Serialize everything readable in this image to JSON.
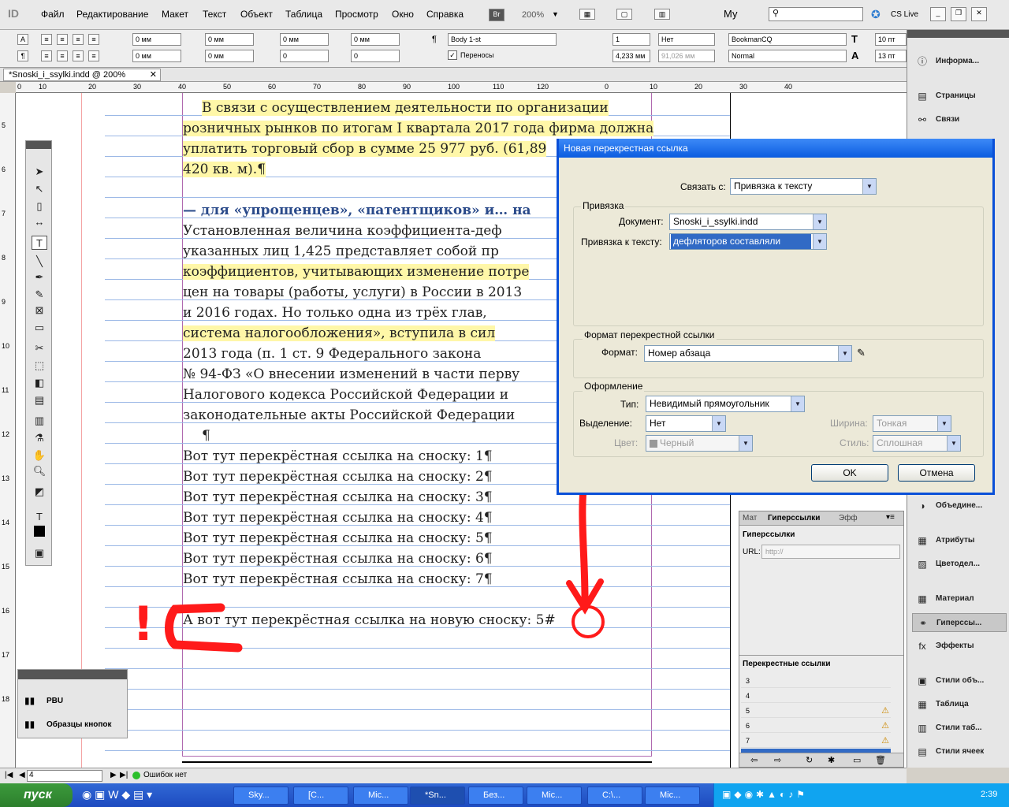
{
  "app": {
    "logo": "ID"
  },
  "menu": [
    "Файл",
    "Редактирование",
    "Макет",
    "Текст",
    "Объект",
    "Таблица",
    "Просмотр",
    "Окно",
    "Справка"
  ],
  "menubar_right": {
    "bridge": "Br",
    "zoom": "200%",
    "workspace": "Му",
    "cs_live": "CS Live"
  },
  "control": {
    "indent_left": "0 мм",
    "indent_right": "0 мм",
    "space_before": "0 мм",
    "space_after": "0 мм",
    "first_line": "0 мм",
    "last_line": "0 мм",
    "dropcap_lines": "0",
    "dropcap_chars": "0",
    "space_before2": "0 мм",
    "space_after2": "0 мм",
    "para_style": "Body 1-st",
    "hyphenation": "Переносы",
    "columns": "1",
    "columns_width": "4,233 мм",
    "span": "Нет",
    "span_width": "91,026 мм",
    "font_family": "BookmanCQ",
    "font_style": "Normal",
    "font_size": "10 пт",
    "leading": "13 пт"
  },
  "doc_tab": "*Snoski_i_ssylki.indd @ 200%",
  "ruler_top": [
    "0",
    "10",
    "20",
    "30",
    "40",
    "50",
    "60",
    "70",
    "80",
    "90",
    "100",
    "110",
    "120",
    "0",
    "10",
    "20",
    "30",
    "40"
  ],
  "ruler_left": [
    "5",
    "6",
    "7",
    "8",
    "9",
    "10",
    "11",
    "12",
    "13",
    "14",
    "15",
    "16",
    "17",
    "18"
  ],
  "text_lines": [
    {
      "t": "В связи с осуществлением деятельности по организации",
      "hl": true,
      "indent": true,
      "bold": false
    },
    {
      "t": "розничных рынков по итогам I квартала 2017 года фирма должна",
      "hl": true,
      "indent": false,
      "bold": false
    },
    {
      "t": "уплатить торговый сбор в сумме 25 977 руб. (61,89",
      "hl": true,
      "indent": false,
      "bold": false
    },
    {
      "t": "420 кв. м).¶",
      "hl": true,
      "indent": false,
      "bold": false
    },
    {
      "t": "— для «упрощенцев», «патентщиков» и… на",
      "hl": false,
      "indent": false,
      "bold": true
    },
    {
      "t": "Установленная величина коэффициента-деф",
      "hl": false,
      "indent": false,
      "bold": false
    },
    {
      "t": "указанных лиц 1,425 представляет собой пр",
      "hl": false,
      "indent": false,
      "bold": false
    },
    {
      "t": "коэффициентов, учитывающих изменение потре",
      "hl": true,
      "indent": false,
      "bold": false
    },
    {
      "t": "цен на товары (работы, услуги) в России в 2013",
      "hl": false,
      "indent": false,
      "bold": false
    },
    {
      "t": "и 2016 годах. Но только одна из трёх глав,",
      "hl": false,
      "indent": false,
      "bold": false
    },
    {
      "t": "система налогообложения», вступила в сил",
      "hl": true,
      "indent": false,
      "bold": false
    },
    {
      "t": "2013 года (п. 1 ст. 9 Федерального закона",
      "hl": false,
      "indent": false,
      "bold": false
    },
    {
      "t": "№ 94-ФЗ «О внесении изменений в части перву",
      "hl": false,
      "indent": false,
      "bold": false
    },
    {
      "t": "Налогового кодекса Российской Федерации и",
      "hl": false,
      "indent": false,
      "bold": false
    },
    {
      "t": "законодательные акты Российской Федерации",
      "hl": false,
      "indent": false,
      "bold": false
    },
    {
      "t": "¶",
      "hl": false,
      "indent": true,
      "bold": false
    },
    {
      "t": "Вот тут перекрёстная ссылка на сноску: 1¶",
      "hl": false,
      "indent": false,
      "bold": false
    },
    {
      "t": "Вот тут перекрёстная ссылка на сноску: 2¶",
      "hl": false,
      "indent": false,
      "bold": false
    },
    {
      "t": "Вот тут перекрёстная ссылка на сноску: 3¶",
      "hl": false,
      "indent": false,
      "bold": false
    },
    {
      "t": "Вот тут перекрёстная ссылка на сноску: 4¶",
      "hl": false,
      "indent": false,
      "bold": false
    },
    {
      "t": "Вот тут перекрёстная ссылка на сноску: 5¶",
      "hl": false,
      "indent": false,
      "bold": false
    },
    {
      "t": "Вот тут перекрёстная ссылка на сноску: 6¶",
      "hl": false,
      "indent": false,
      "bold": false
    },
    {
      "t": "Вот тут перекрёстная ссылка на сноску: 7¶",
      "hl": false,
      "indent": false,
      "bold": false
    },
    {
      "t": "",
      "hl": false,
      "indent": false,
      "bold": false
    },
    {
      "t": "А вот тут перекрёстная ссылка на новую сноску: 5#",
      "hl": false,
      "indent": false,
      "bold": false
    }
  ],
  "dialog": {
    "title": "Новая перекрестная ссылка",
    "link_to_label": "Связать с:",
    "link_to_value": "Привязка к тексту",
    "anchor_group": "Привязка",
    "document_label": "Документ:",
    "document_value": "Snoski_i_ssylki.indd",
    "text_anchor_label": "Привязка к тексту:",
    "text_anchor_value": "дефляторов составляли",
    "format_group": "Формат перекрестной ссылки",
    "format_label": "Формат:",
    "format_value": "Номер абзаца",
    "appearance_group": "Оформление",
    "type_label": "Тип:",
    "type_value": "Невидимый прямоугольник",
    "highlight_label": "Выделение:",
    "highlight_value": "Нет",
    "width_label": "Ширина:",
    "width_value": "Тонкая",
    "color_label": "Цвет:",
    "color_value": "Черный",
    "style_label": "Стиль:",
    "style_value": "Сплошная",
    "ok": "OK",
    "cancel": "Отмена"
  },
  "dock": [
    "Информа...",
    "Страницы",
    "Связи",
    "Объедине...",
    "Атрибуты",
    "Цветодел...",
    "Материал",
    "Гиперссы...",
    "Эффекты",
    "Стили объ...",
    "Таблица",
    "Стили таб...",
    "Стили ячеек"
  ],
  "hyper_panel": {
    "tabs": [
      "Мат",
      "Гиперссылки",
      "Эфф"
    ],
    "title": "Гиперссылки",
    "url_label": "URL:",
    "url_placeholder": "http://",
    "xref_title": "Перекрестные ссылки",
    "xrefs": [
      {
        "n": "3",
        "warn": false
      },
      {
        "n": "4",
        "warn": false
      },
      {
        "n": "5",
        "warn": true
      },
      {
        "n": "6",
        "warn": true
      },
      {
        "n": "7",
        "warn": true
      },
      {
        "n": "5",
        "warn": false,
        "sel": true
      }
    ]
  },
  "float_panel": {
    "items": [
      "PBU",
      "Образцы кнопок"
    ]
  },
  "status": {
    "page": "4",
    "errors": "Ошибок нет"
  },
  "taskbar": {
    "start": "пуск",
    "tasks": [
      "Sky...",
      "[C...",
      "Mic...",
      "*Sn...",
      "Без...",
      "Mic...",
      "C:\\...",
      "Mic..."
    ],
    "clock": "2:39"
  },
  "annotation": {
    "mark": "!"
  },
  "colors": {
    "selection": "#316ac5",
    "annotation": "#ff1a1a",
    "dialog_title": "#0b5ce0",
    "highlight": "#fff7a8"
  }
}
